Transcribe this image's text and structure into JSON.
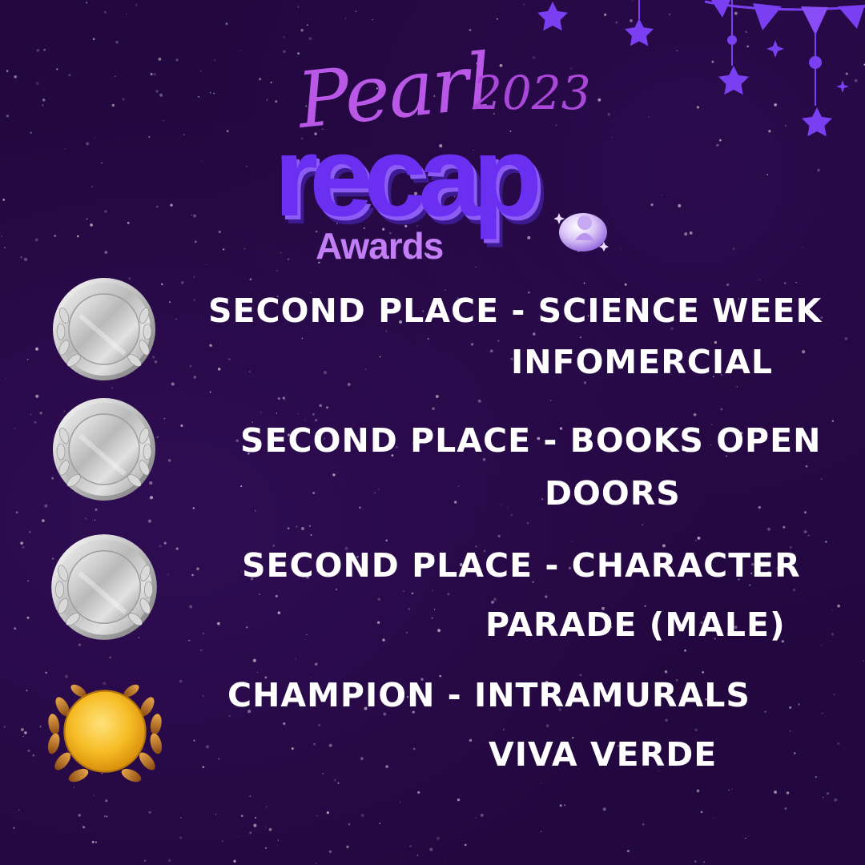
{
  "logo": {
    "pearl_text": "Pearl",
    "year": "2023",
    "recap_text": "recap",
    "awards_text": "Awards"
  },
  "awards": [
    {
      "medal": "silver-medal-icon",
      "line1": "SECOND PLACE - SCIENCE WEEK",
      "line2": "INFOMERCIAL"
    },
    {
      "medal": "silver-medal-icon",
      "line1": "SECOND PLACE - BOOKS OPEN",
      "line2": "DOORS"
    },
    {
      "medal": "silver-medal-icon",
      "line1": "SECOND PLACE - CHARACTER",
      "line2": "PARADE (MALE)"
    },
    {
      "medal": "gold-medal-icon",
      "line1": "CHAMPION - INTRAMURALS",
      "line2": "VIVA VERDE"
    }
  ],
  "colors": {
    "background": "#23073f",
    "title_purple": "#6a2ff0",
    "accent_violet": "#b957e6",
    "decor_violet": "#7b3ff2",
    "text": "#ffffff",
    "silver": "#c8c8c8",
    "gold": "#f2b21b"
  },
  "icons": [
    "star-icon",
    "bunting-flag-icon",
    "hanging-star-icon",
    "pearl-icon",
    "silver-medal-icon",
    "gold-medal-icon",
    "laurel-wreath-icon"
  ]
}
